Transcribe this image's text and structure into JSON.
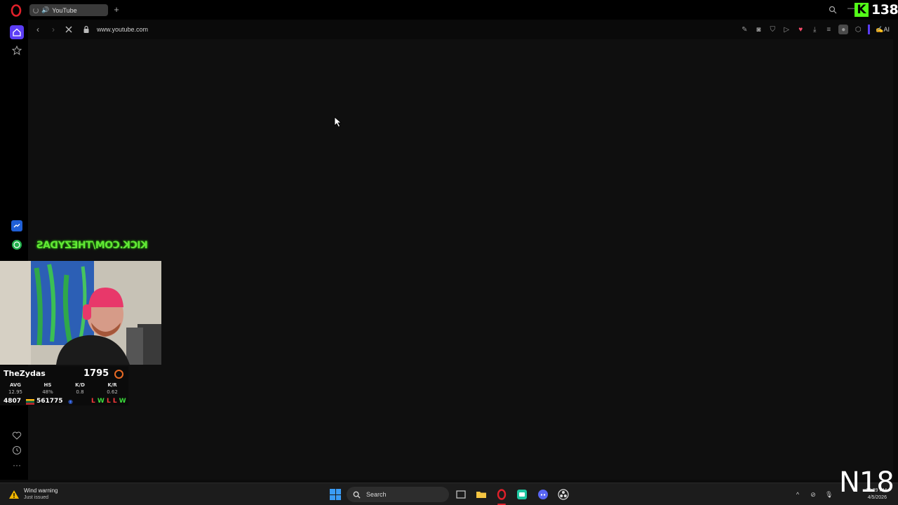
{
  "browser": {
    "tab_title": "YouTube",
    "tab_audio_icon": "speaker-icon",
    "url": "www.youtube.com",
    "ai_label": "AI"
  },
  "overlay": {
    "viewer_count": "138",
    "kick_letter": "K",
    "mirrored_text": "KICK.COM/THEZYDAS",
    "corner_label": "N18"
  },
  "stats": {
    "name": "TheZydas",
    "elo": "1795",
    "columns": [
      {
        "label": "AVG",
        "value": "12.95"
      },
      {
        "label": "HS",
        "value": "48%"
      },
      {
        "label": "K/D",
        "value": "0.8"
      },
      {
        "label": "K/R",
        "value": "0.62"
      }
    ],
    "matches": "4807",
    "points": "561775",
    "recent": [
      "L",
      "W",
      "L",
      "L",
      "W"
    ]
  },
  "taskbar": {
    "weather_title": "Wind warning",
    "weather_sub": "Just issued",
    "search_label": "Search",
    "time": "10:29 PM",
    "date": "4/5/2026"
  },
  "colors": {
    "accent_purple": "#5b3df5",
    "kick_green": "#53fc18",
    "win_blue": "#3a9cf5"
  }
}
